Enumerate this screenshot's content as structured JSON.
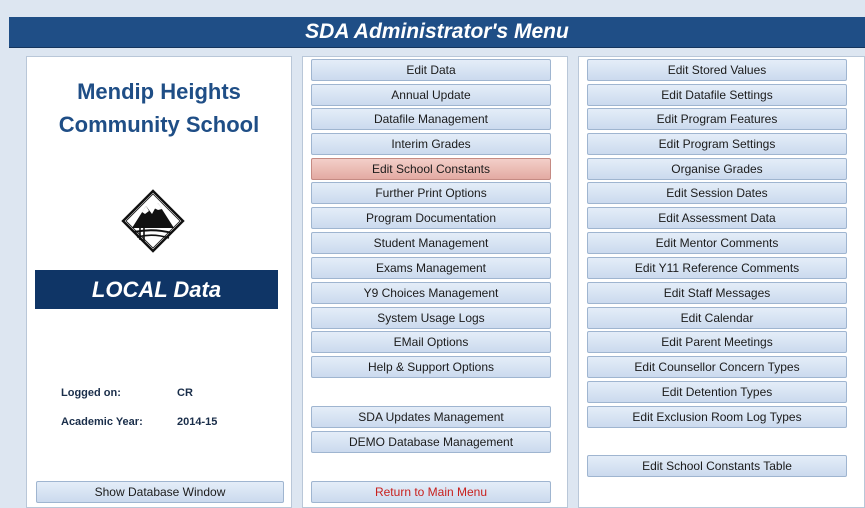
{
  "title": "SDA Administrator's Menu",
  "left": {
    "school_name": "Mendip Heights Community School",
    "logo_icon": "mountain-logo-icon",
    "banner": "LOCAL Data",
    "logged_on_label": "Logged on:",
    "logged_on_value": "CR",
    "academic_year_label": "Academic Year:",
    "academic_year_value": "2014-15",
    "show_db_button": "Show Database Window"
  },
  "middle": {
    "buttons": [
      "Edit Data",
      "Annual Update",
      "Datafile Management",
      "Interim Grades",
      "Edit School Constants",
      "Further Print Options",
      "Program Documentation",
      "Student Management",
      "Exams Management",
      "Y9 Choices Management",
      "System Usage Logs",
      "EMail Options",
      "Help & Support Options"
    ],
    "selected_button": "Edit School Constants",
    "updates_button": "SDA Updates Management",
    "demo_button": "DEMO Database Management",
    "return_button": "Return to Main Menu"
  },
  "right": {
    "buttons": [
      "Edit Stored Values",
      "Edit Datafile Settings",
      "Edit Program Features",
      "Edit Program Settings",
      "Organise Grades",
      "Edit Session Dates",
      "Edit Assessment Data",
      "Edit Mentor Comments",
      "Edit Y11 Reference Comments",
      "Edit Staff Messages",
      "Edit Calendar",
      "Edit Parent Meetings",
      "Edit Counsellor Concern Types",
      "Edit Detention Types",
      "Edit Exclusion Room Log Types"
    ],
    "constants_table_button": "Edit School Constants Table"
  },
  "colors": {
    "title_bar": "#1f4e86",
    "banner": "#0f3566",
    "school_name": "#1f4e86",
    "selected_button": "#e3aaa2",
    "return_text": "#c8201d"
  }
}
